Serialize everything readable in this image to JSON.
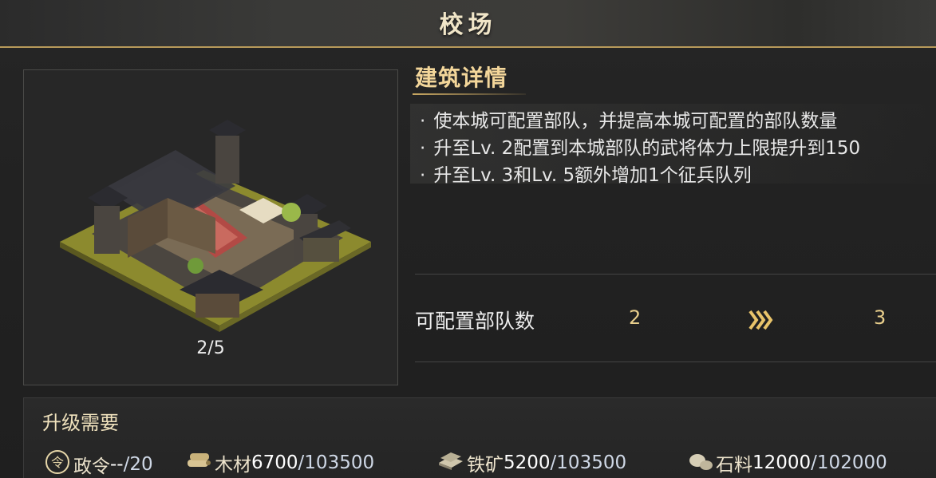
{
  "window": {
    "title": "校场"
  },
  "building": {
    "level_text": "2/5",
    "image_icon": "barracks-courtyard-icon"
  },
  "details": {
    "title": "建筑详情",
    "bullet": "·",
    "lines": [
      "使本城可配置部队，并提高本城可配置的部队数量",
      "升至Lv. 2配置到本城部队的武将体力上限提升到150",
      "升至Lv. 3和Lv. 5额外增加1个征兵队列"
    ]
  },
  "stat": {
    "label": "可配置部队数",
    "from": "2",
    "to": "3",
    "arrow_icon": "triple-chevron-right-icon"
  },
  "upgrade": {
    "title": "升级需要",
    "resources": [
      {
        "icon": "decree-seal-icon",
        "name": "政令",
        "amount": "--",
        "sep": "/",
        "need": "20"
      },
      {
        "icon": "wood-logs-icon",
        "name": "木材",
        "amount": "6700",
        "sep": "/",
        "need": "103500"
      },
      {
        "icon": "iron-ingots-icon",
        "name": "铁矿",
        "amount": "5200",
        "sep": "/",
        "need": "103500"
      },
      {
        "icon": "stone-icon",
        "name": "石料",
        "amount": "12000",
        "sep": "/",
        "need": "102000"
      }
    ]
  },
  "colors": {
    "accent_gold": "#f3d69a",
    "value_gold": "#e9cf8c",
    "border_gold": "#b89a5a"
  }
}
